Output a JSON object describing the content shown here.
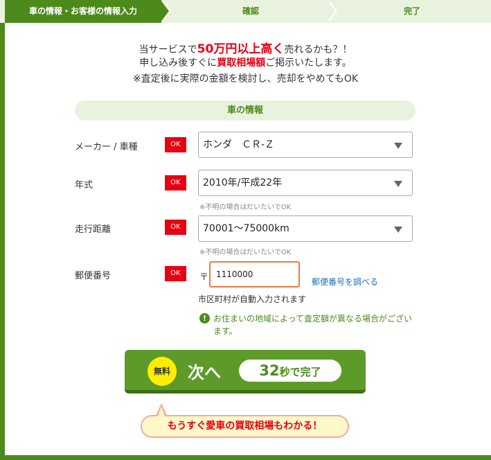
{
  "steps": [
    {
      "label": "車の情報・お客様の情報入力"
    },
    {
      "label": "確認"
    },
    {
      "label": "完了"
    }
  ],
  "intro": {
    "line1_pre": "当サービスで",
    "line1_highlight": "50万円以上高く",
    "line1_post": "売れるかも？！",
    "line2_pre": "申し込み後すぐに",
    "line2_highlight": "買取相場額",
    "line2_post": "ご掲示いたします。",
    "line3": "※査定後に実際の金額を検討し、売却をやめてもOK"
  },
  "section": {
    "title": "車の情報"
  },
  "fields": {
    "maker": {
      "label": "メーカー / 車種",
      "status": "OK",
      "value": "ホンダ　ＣＲ-Ｚ"
    },
    "year": {
      "label": "年式",
      "status": "OK",
      "value": "2010年/平成22年",
      "note": "※不明の場合はだいたいでOK"
    },
    "mileage": {
      "label": "走行距離",
      "status": "OK",
      "value": "70001～75000km",
      "note": "※不明の場合はだいたいでOK"
    },
    "postal": {
      "label": "郵便番号",
      "status": "OK",
      "mark": "〒",
      "value": "1110000",
      "link": "郵便番号を調べる",
      "autofill": "市区町村が自動入力されます"
    }
  },
  "info": {
    "text": "お住まいの地域によって査定額が異なる場合がございます。"
  },
  "next_button": {
    "badge": "無料",
    "label": "次へ",
    "time_num": "32",
    "time_text": "秒で完了"
  },
  "bubble": {
    "text": "もうすぐ愛車の買取相場もわかる！"
  },
  "colors": {
    "brand_green": "#4d8a1c",
    "accent_red": "#e60012",
    "light_green": "#e9f2df"
  }
}
